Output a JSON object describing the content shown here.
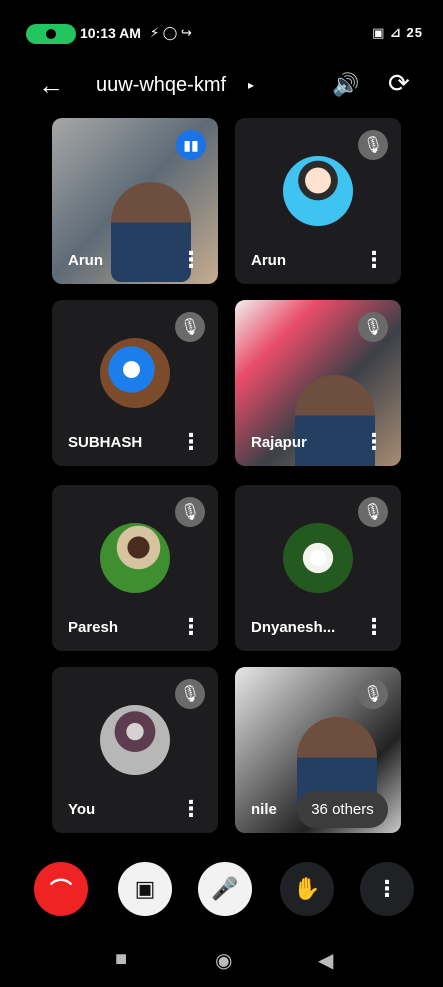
{
  "status": {
    "time": "10:13 AM",
    "left_icons": "⚡ ◯ ↪",
    "right_icons": "▣ ⊿ 25"
  },
  "topbar": {
    "back_icon": "←",
    "meeting_code": "uuw-whqe-kmf",
    "meeting_chevron": "▸",
    "speaker_icon": "🔊",
    "switch_icon": "⟳"
  },
  "participants": [
    {
      "name": "Arun",
      "state": "speaking"
    },
    {
      "name": "Arun",
      "state": "muted"
    },
    {
      "name": "SUBHASH",
      "state": "muted"
    },
    {
      "name": "Rajapur",
      "state": "muted"
    },
    {
      "name": "Paresh",
      "state": "muted"
    },
    {
      "name": "Dnyanesh...",
      "state": "muted"
    },
    {
      "name": "You",
      "state": "muted"
    },
    {
      "name": "nile",
      "state": "muted"
    }
  ],
  "others": "36 others",
  "controls": {
    "end": "⌒",
    "camera": "▣",
    "mic": "🎤",
    "hand": "✋",
    "more": "⋮"
  },
  "nav": {
    "recent": "■",
    "home": "◉",
    "back": "◀"
  },
  "colors": {
    "background": "#000000",
    "tile": "#1d1d1f",
    "end_call": "#ef2323",
    "active": "#1a73e8"
  }
}
